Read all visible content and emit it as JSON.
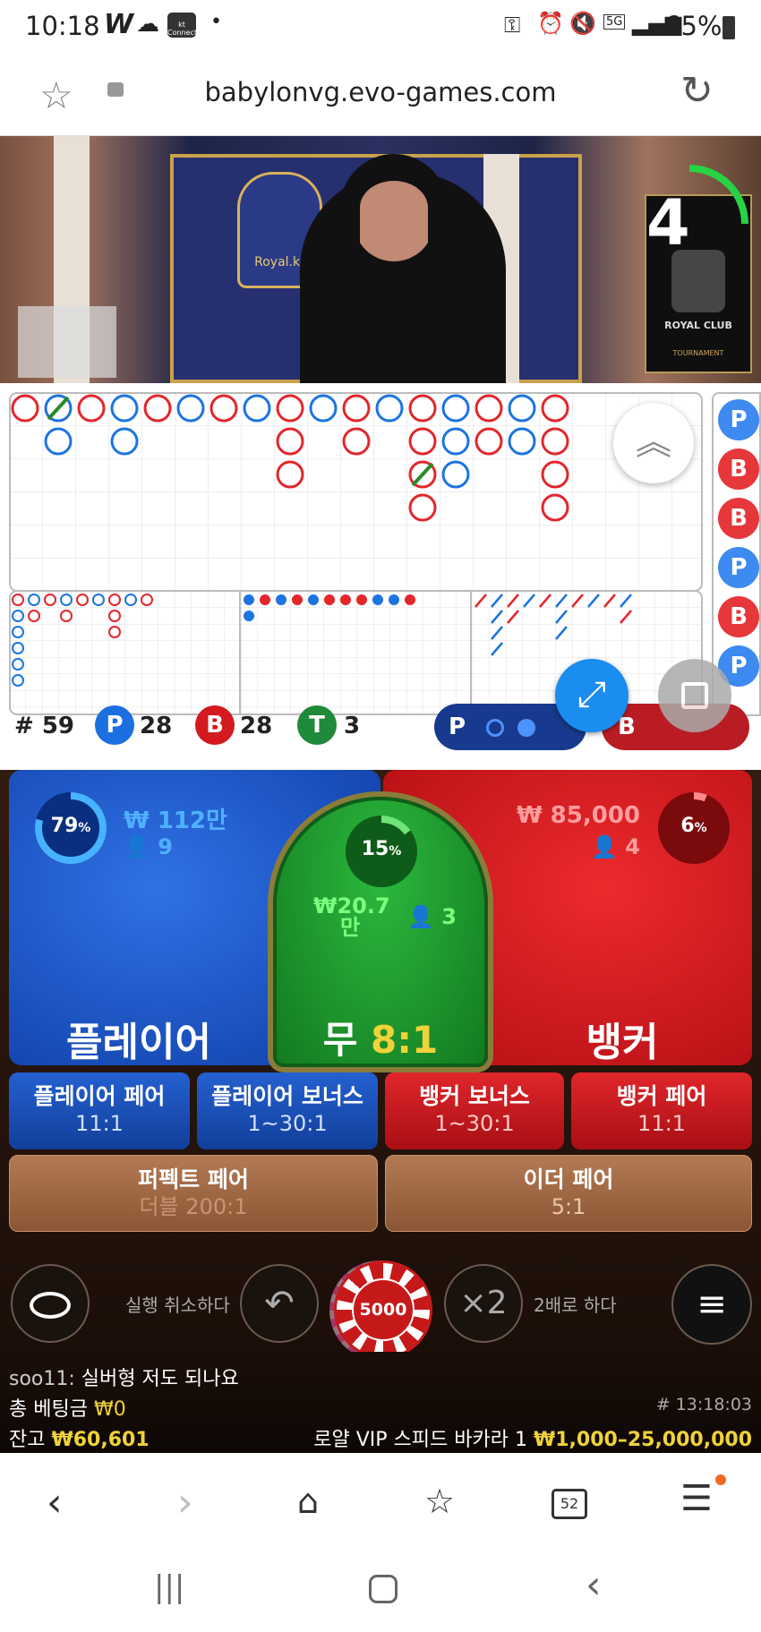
{
  "status_bar": {
    "time": "10:18",
    "app_letter": "W",
    "carrier_logo": "kt Connect",
    "network": "5G",
    "battery": "65%"
  },
  "browser": {
    "url": "babylonvg.evo-games.com"
  },
  "video": {
    "countdown": "4",
    "table_logo": "Royal.kr",
    "sign_title": "ROYAL CLUB",
    "sign_sub": "TOURNAMENT"
  },
  "roads": {
    "shoe_count": "# 59",
    "player_count": "28",
    "banker_count": "28",
    "tie_count": "3",
    "p_letter": "P",
    "b_letter": "B",
    "t_letter": "T",
    "predict_p": "P",
    "predict_b": "B"
  },
  "bets": {
    "player": {
      "label": "플레이어",
      "pct": "79",
      "amount": "₩ 112만",
      "players": "9"
    },
    "tie": {
      "label": "무",
      "odds": "8:1",
      "pct": "15",
      "amount_line1": "₩20.7",
      "amount_line2": "만",
      "players": "3"
    },
    "banker": {
      "label": "뱅커",
      "pct": "6",
      "amount": "₩ 85,000",
      "players": "4"
    },
    "pct_sign": "%"
  },
  "side_bets": [
    {
      "label": "플레이어 페어",
      "odds": "11:1"
    },
    {
      "label": "플레이어 보너스",
      "odds": "1~30:1"
    },
    {
      "label": "뱅커 보너스",
      "odds": "1~30:1"
    },
    {
      "label": "뱅커 페어",
      "odds": "11:1"
    }
  ],
  "pair_bets": [
    {
      "label": "퍼펙트 페어",
      "odds": "더블 200:1"
    },
    {
      "label": "이더 페어",
      "odds": "5:1"
    }
  ],
  "controls": {
    "undo_label": "실행 취소하다",
    "chip_value": "5000",
    "double_symbol": "×2",
    "double_label": "2배로 하다"
  },
  "footer": {
    "chat_user": "soo11:",
    "chat_msg": "실버형 저도 되나요",
    "total_bet_label": "총 베팅금",
    "total_bet_value": "₩0",
    "game_id": "# 13:18:03",
    "balance_label": "잔고",
    "balance_value": "₩60,601",
    "table_name": "로얄 VIP 스피드 바카라 1",
    "limits": "₩1,000–25,000,000"
  },
  "browser_nav": {
    "tab_count": "52"
  },
  "colors": {
    "player_blue": "#1f57c9",
    "banker_red": "#d3161b",
    "tie_green": "#1e9a2d",
    "odds_yellow": "#f0d23a"
  }
}
